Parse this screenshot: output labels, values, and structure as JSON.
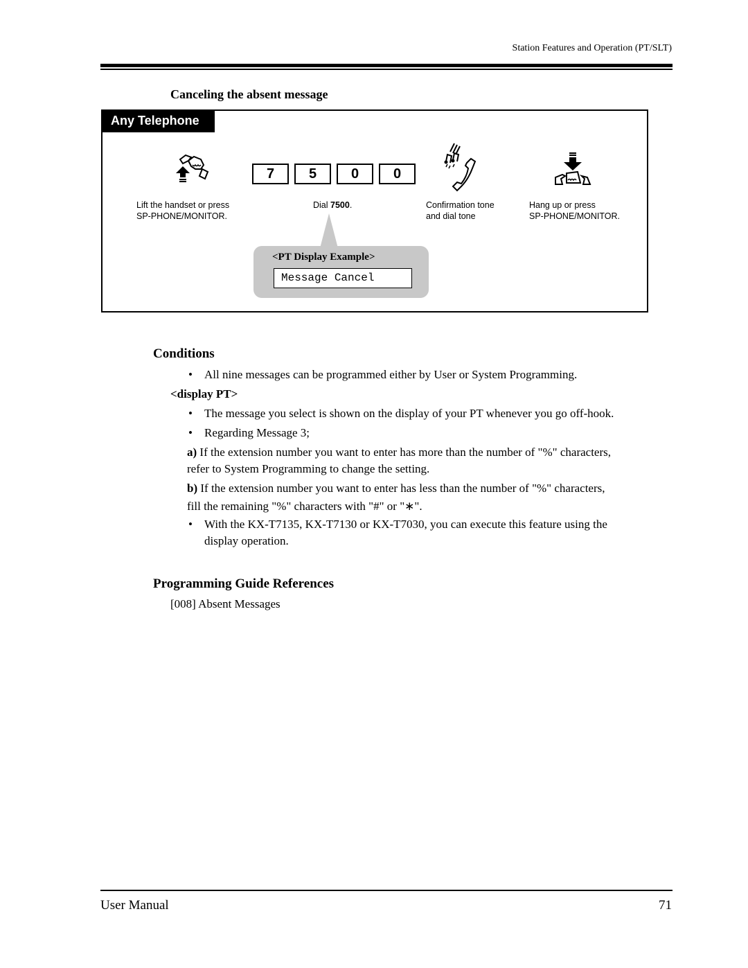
{
  "header": {
    "running_head": "Station Features and Operation (PT/SLT)"
  },
  "procedure": {
    "title": "Canceling the absent message",
    "tab_label": "Any Telephone",
    "steps": [
      {
        "icon": "lift-handset-icon",
        "caption_line1": "Lift the handset or press",
        "caption_line2": "SP-PHONE/MONITOR."
      },
      {
        "icon": "dial-keys",
        "keys": [
          "7",
          "5",
          "0",
          "0"
        ],
        "caption_prefix": "Dial ",
        "caption_bold": "7500",
        "caption_suffix": "."
      },
      {
        "icon": "confirmation-tone-icon",
        "caption_line1": "Confirmation tone",
        "caption_line2": "and dial tone"
      },
      {
        "icon": "hang-up-icon",
        "caption_line1": "Hang up or press",
        "caption_line2": "SP-PHONE/MONITOR."
      }
    ],
    "display_example": {
      "title": "<PT Display Example>",
      "lcd_text": "Message Cancel"
    }
  },
  "conditions": {
    "heading": "Conditions",
    "bullet1": "All nine messages can be programmed either by User or System Programming.",
    "subheading": "<display PT>",
    "bullet2": "The message you select is shown on the display of your PT whenever you go off-hook.",
    "bullet3": "Regarding Message 3;",
    "item_a_label": "a)",
    "item_a_line1": " If the extension number you want to enter has more than the number of \"%\" characters,",
    "item_a_line2": "refer to System Programming to change the setting.",
    "item_b_label": "b)",
    "item_b_line1": " If the extension number you want to enter has less than the number of \"%\" characters,",
    "item_b_line2": "fill the remaining \"%\" characters with \"#\" or \"∗\".",
    "bullet4_line1": "With the KX-T7135, KX-T7130 or KX-T7030, you can execute this feature using the",
    "bullet4_line2": "display operation.",
    "bullet_glyph": "•"
  },
  "references": {
    "heading": "Programming Guide References",
    "item": "[008] Absent Messages"
  },
  "footer": {
    "left": "User Manual",
    "page_number": "71"
  }
}
